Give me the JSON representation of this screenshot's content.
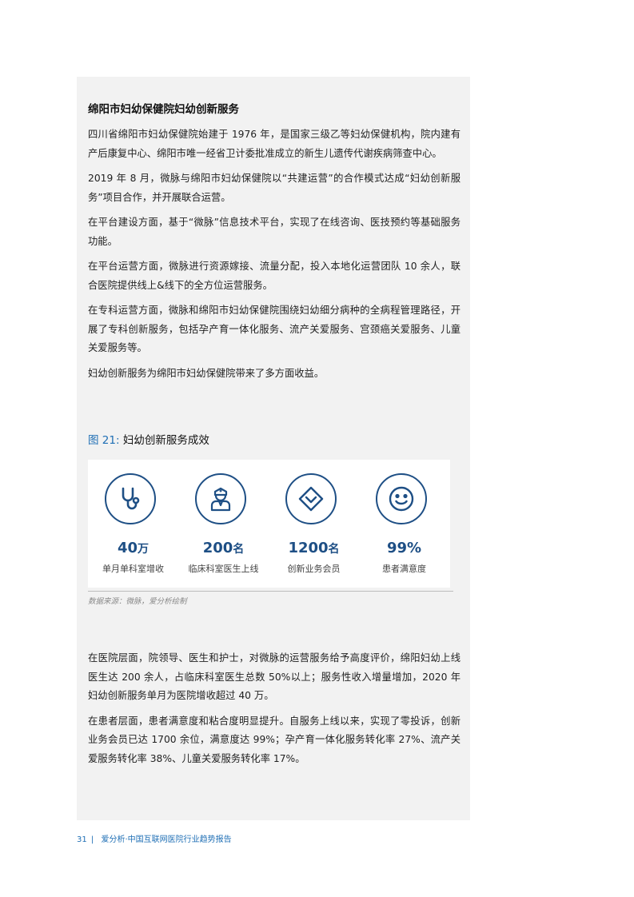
{
  "section": {
    "title": "绵阳市妇幼保健院妇幼创新服务",
    "paragraphs": [
      "四川省绵阳市妇幼保健院始建于 1976 年，是国家三级乙等妇幼保健机构，院内建有产后康复中心、绵阳市唯一经省卫计委批准成立的新生儿遗传代谢疾病筛查中心。",
      "2019 年 8 月，微脉与绵阳市妇幼保健院以“共建运营”的合作模式达成“妇幼创新服务”项目合作，并开展联合运营。",
      "在平台建设方面，基于“微脉”信息技术平台，实现了在线咨询、医技预约等基础服务功能。",
      "在平台运营方面，微脉进行资源嫁接、流量分配，投入本地化运营团队 10 余人，联合医院提供线上&线下的全方位运营服务。",
      "在专科运营方面，微脉和绵阳市妇幼保健院围绕妇幼细分病种的全病程管理路径，开展了专科创新服务，包括孕产育一体化服务、流产关爱服务、宫颈癌关爱服务、儿童关爱服务等。",
      "妇幼创新服务为绵阳市妇幼保健院带来了多方面收益。"
    ]
  },
  "figure": {
    "number": "图 21:",
    "title": "妇幼创新服务成效",
    "source": "数据来源：微脉，爱分析绘制",
    "stats": [
      {
        "icon": "stethoscope-icon",
        "number": "40",
        "unit": "万",
        "label": "单月单科室增收"
      },
      {
        "icon": "doctor-icon",
        "number": "200",
        "unit": "名",
        "label": "临床科室医生上线"
      },
      {
        "icon": "diamond-check-icon",
        "number": "1200",
        "unit": "名",
        "label": "创新业务会员"
      },
      {
        "icon": "smiley-icon",
        "number": "99%",
        "unit": "",
        "label": "患者满意度"
      }
    ],
    "accent_color": "#1e4f85"
  },
  "closing": {
    "paragraphs": [
      "在医院层面，院领导、医生和护士，对微脉的运营服务给予高度评价，绵阳妇幼上线医生达 200 余人，占临床科室医生总数 50%以上；服务性收入增量增加，2020 年妇幼创新服务单月为医院增收超过 40 万。",
      "在患者层面，患者满意度和粘合度明显提升。自服务上线以来，实现了零投诉，创新业务会员已达 1700 余位，满意度达 99%；孕产育一体化服务转化率 27%、流产关爱服务转化率 38%、儿童关爱服务转化率 17%。"
    ]
  },
  "footer": {
    "page": "31",
    "separator": "|",
    "text": "爱分析·中国互联网医院行业趋势报告"
  }
}
